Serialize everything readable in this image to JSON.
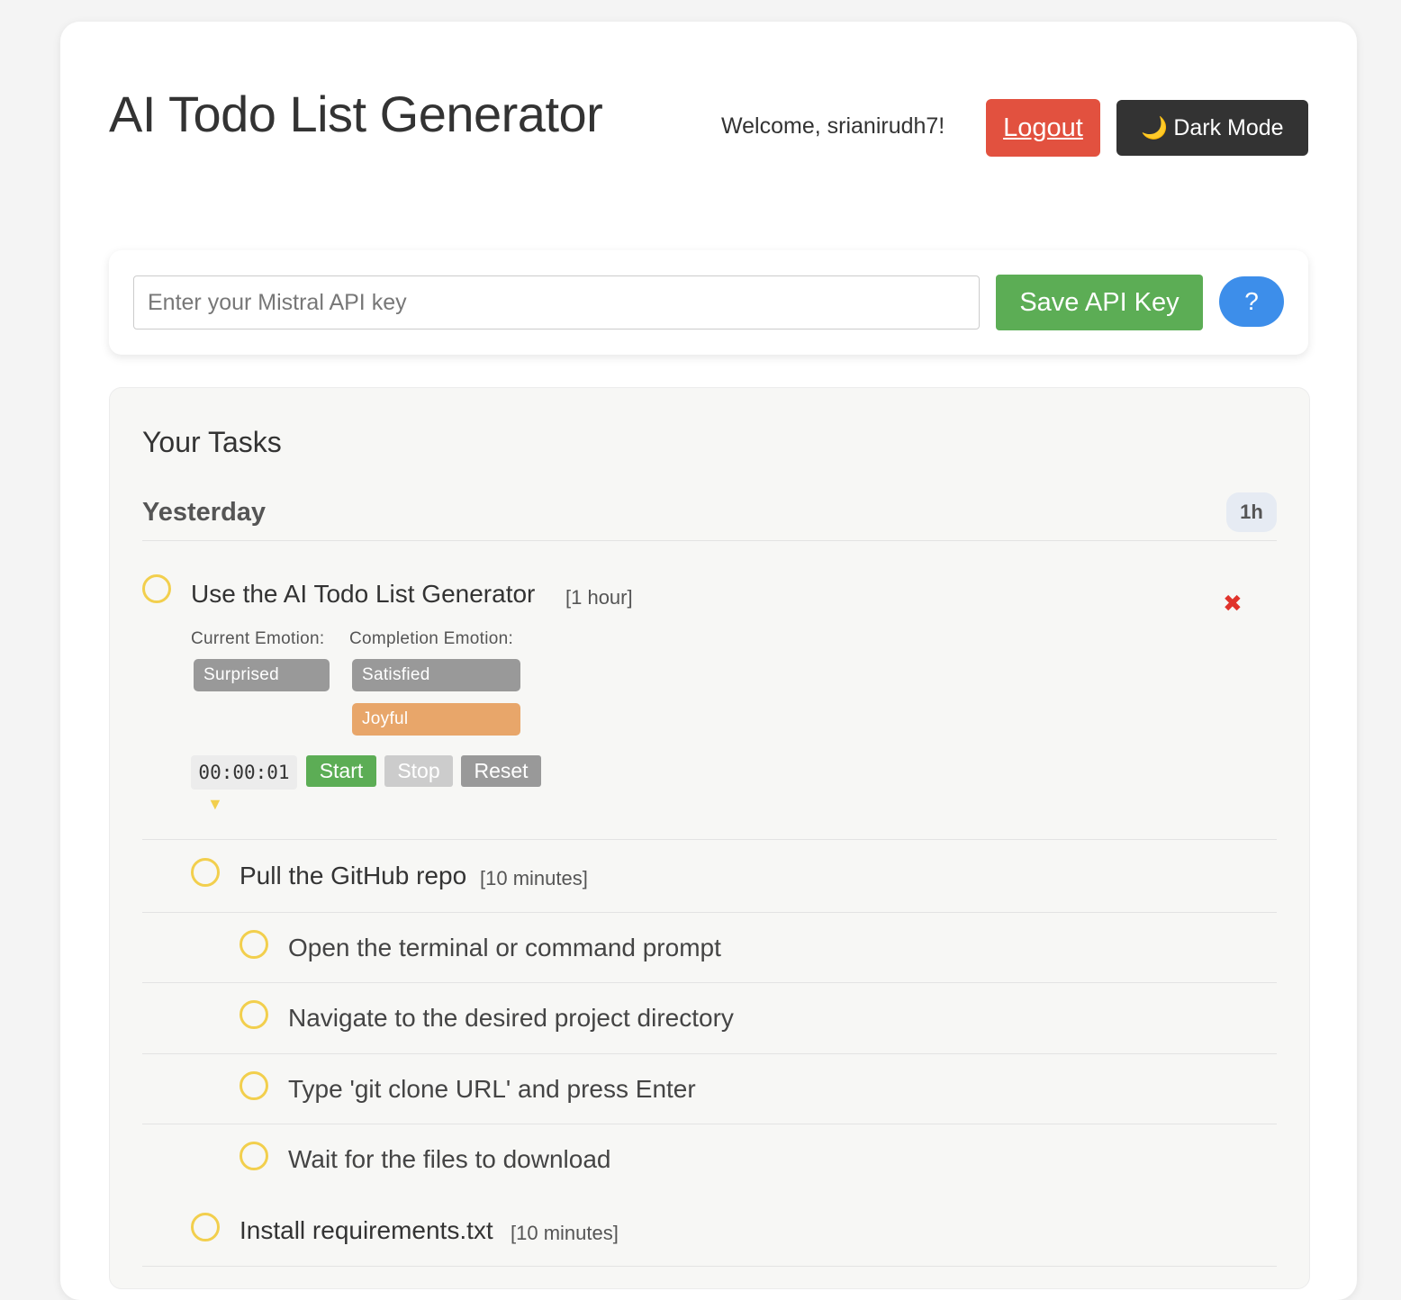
{
  "header": {
    "title": "AI Todo List Generator",
    "welcome": "Welcome, srianirudh7!",
    "logout_label": "Logout",
    "dark_mode_icon": "🌙",
    "dark_mode_label": "Dark Mode"
  },
  "api": {
    "placeholder": "Enter your Mistral API key",
    "value": "",
    "save_label": "Save API Key",
    "help_label": "?"
  },
  "tasks": {
    "heading": "Your Tasks",
    "groups": [
      {
        "label": "Yesterday",
        "total": "1h",
        "main_task": {
          "title": "Use the AI Todo List Generator",
          "duration": "[1 hour]",
          "delete_icon": "✖",
          "current_emotion_label": "Current Emotion:",
          "completion_emotion_label": "Completion Emotion:",
          "current_emotions": [
            "Surprised"
          ],
          "completion_emotions": [
            "Satisfied",
            "Joyful"
          ],
          "timer": "00:00:01",
          "start_label": "Start",
          "stop_label": "Stop",
          "reset_label": "Reset",
          "expand_icon": "▼"
        },
        "subtasks": [
          {
            "title": "Pull the GitHub repo",
            "duration": "[10 minutes]"
          },
          {
            "title": "Open the terminal or command prompt"
          },
          {
            "title": "Navigate to the desired project directory"
          },
          {
            "title": "Type 'git clone URL' and press Enter"
          },
          {
            "title": "Wait for the files to download"
          },
          {
            "title": "Install requirements.txt",
            "duration": "[10 minutes]"
          }
        ]
      }
    ]
  },
  "colors": {
    "logout": "#e2513f",
    "dark_button": "#333333",
    "save": "#5cad55",
    "help": "#3d8eea",
    "circle": "#f2cf4d",
    "emotion_gray": "#999999",
    "emotion_joyful": "#e8a66a",
    "start": "#5cad55",
    "stop": "#cccccc",
    "reset": "#999999",
    "delete": "#e0332b"
  }
}
